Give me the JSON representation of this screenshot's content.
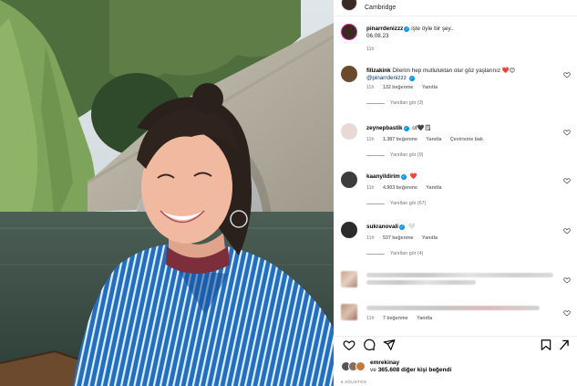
{
  "post": {
    "location": "Cambridge",
    "author": "pinarrdenizzz",
    "caption": "işte öyle bir şey..",
    "caption_date": "06.08.23",
    "caption_age": "11h"
  },
  "comments": [
    {
      "username": "filizakink",
      "verified": false,
      "text": "Dilerim hep mutluluktan olur göz yaşlarınız ❤️😊",
      "mention": "@pinarrdenizzz",
      "age": "11h",
      "likes": "132 beğenme",
      "reply": "Yanıtla",
      "extra": "",
      "view_replies": "Yanıtları gör (3)",
      "avatar_color": "#6b4a2b"
    },
    {
      "username": "zeynepbastik",
      "verified": true,
      "text": "of🖤🗒",
      "mention": "",
      "age": "11h",
      "likes": "1.387 beğenme",
      "reply": "Yanıtla",
      "extra": "Çevirisine bak",
      "view_replies": "Yanıtları gör (9)",
      "avatar_color": "#e8d8d0"
    },
    {
      "username": "kaanyildirim",
      "verified": true,
      "text": "❤️",
      "mention": "",
      "age": "11h",
      "likes": "4.903 beğenme",
      "reply": "Yanıtla",
      "extra": "",
      "view_replies": "Yanıtları gör (67)",
      "avatar_color": "#3c3c3c"
    },
    {
      "username": "sukranovali",
      "verified": true,
      "text": "🤍",
      "mention": "",
      "age": "11h",
      "likes": "537 beğenme",
      "reply": "Yanıtla",
      "extra": "",
      "view_replies": "Yanıtları gör (4)",
      "avatar_color": "#2b2b2b"
    }
  ],
  "blurred_comments": [
    {
      "age": "",
      "likes": "",
      "reply": ""
    },
    {
      "age": "11h",
      "likes": "7 beğenme",
      "reply": "Yanıtla"
    }
  ],
  "likes_summary": {
    "first_user": "emrekinay",
    "prefix": "ve",
    "count": "365.608",
    "suffix": "diğer kişi beğendi"
  },
  "post_date": "6 AĞUSTOS",
  "colors": {
    "verified": "#0095f6",
    "heart_red": "#ed4956",
    "muted_text": "#737373",
    "mention": "#00376b"
  },
  "icons": [
    "heart-icon",
    "comment-icon",
    "share-icon",
    "bookmark-icon",
    "more-icon"
  ]
}
